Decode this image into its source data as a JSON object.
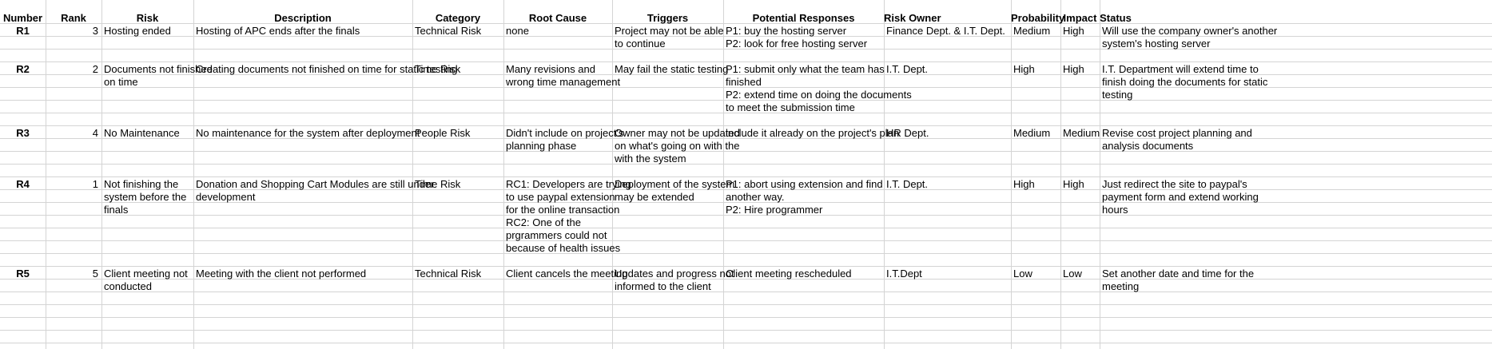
{
  "sheet": {
    "headers": [
      "Number",
      "Rank",
      "Risk",
      "Description",
      "Category",
      "Root Cause",
      "Triggers",
      "Potential Responses",
      "Risk Owner",
      "Probability",
      "Impact",
      "Status"
    ],
    "risks": [
      {
        "number": "R1",
        "rank": "3",
        "risk": [
          "Hosting ended"
        ],
        "description": [
          "Hosting of APC ends after the finals"
        ],
        "category": [
          "Technical Risk"
        ],
        "root_cause": [
          "none"
        ],
        "triggers": [
          "Project may not be able",
          "to continue"
        ],
        "responses": [
          "P1: buy the hosting server",
          "P2: look for free hosting server"
        ],
        "owner": [
          "Finance Dept. & I.T. Dept."
        ],
        "probability": "Medium",
        "impact": "High",
        "status": [
          "Will use the company owner's another",
          "system's hosting server"
        ]
      },
      {
        "number": "R2",
        "rank": "2",
        "risk": [
          "Documents not finished",
          "on time"
        ],
        "description": [
          "Creating documents not finished on time for static testing"
        ],
        "category": [
          "Time Risk"
        ],
        "root_cause": [
          "Many revisions and",
          "wrong time management"
        ],
        "triggers": [
          "May fail the static testing"
        ],
        "responses": [
          "P1: submit only what the team has",
          "finished",
          "P2: extend time on doing the documents",
          "to meet the submission time"
        ],
        "owner": [
          "I.T. Dept."
        ],
        "probability": "High",
        "impact": "High",
        "status": [
          "I.T. Department will extend time to",
          "finish doing the documents for static",
          "testing"
        ]
      },
      {
        "number": "R3",
        "rank": "4",
        "risk": [
          "No Maintenance"
        ],
        "description": [
          "No maintenance for the system after deployment"
        ],
        "category": [
          "People Risk"
        ],
        "root_cause": [
          "Didn't include on project's",
          "planning phase"
        ],
        "triggers": [
          "Owner may not be updated",
          "on what's going on with the",
          "with the system"
        ],
        "responses": [
          "include it already on the project's plan"
        ],
        "owner": [
          "HR Dept."
        ],
        "probability": "Medium",
        "impact": "Medium",
        "status": [
          "Revise cost project planning and",
          "analysis documents"
        ]
      },
      {
        "number": "R4",
        "rank": "1",
        "risk": [
          "Not finishing the",
          "system before the",
          "finals"
        ],
        "description": [
          "Donation and Shopping Cart Modules are still under",
          "development"
        ],
        "category": [
          "Time Risk"
        ],
        "root_cause": [
          "RC1: Developers are trying",
          "to use paypal extension",
          "for the online transaction",
          "RC2: One of the",
          "prgrammers could not",
          "because of health issues"
        ],
        "triggers": [
          "Deployment of the system",
          "may be extended"
        ],
        "responses": [
          "P1: abort using extension and find",
          "another way.",
          "P2: Hire programmer"
        ],
        "owner": [
          "I.T. Dept."
        ],
        "probability": "High",
        "impact": "High",
        "status": [
          "Just redirect the site to paypal's",
          "payment form and extend working",
          "hours"
        ]
      },
      {
        "number": "R5",
        "rank": "5",
        "risk": [
          "Client meeting not",
          "conducted"
        ],
        "description": [
          "Meeting with the client not performed"
        ],
        "category": [
          "Technical Risk"
        ],
        "root_cause": [
          "Client cancels the meeting"
        ],
        "triggers": [
          "Updates and progress not",
          "informed to the client"
        ],
        "responses": [
          "Client meeting rescheduled"
        ],
        "owner": [
          "I.T.Dept"
        ],
        "probability": "Low",
        "impact": "Low",
        "status": [
          "Set another date and time for the",
          "meeting"
        ]
      }
    ]
  }
}
